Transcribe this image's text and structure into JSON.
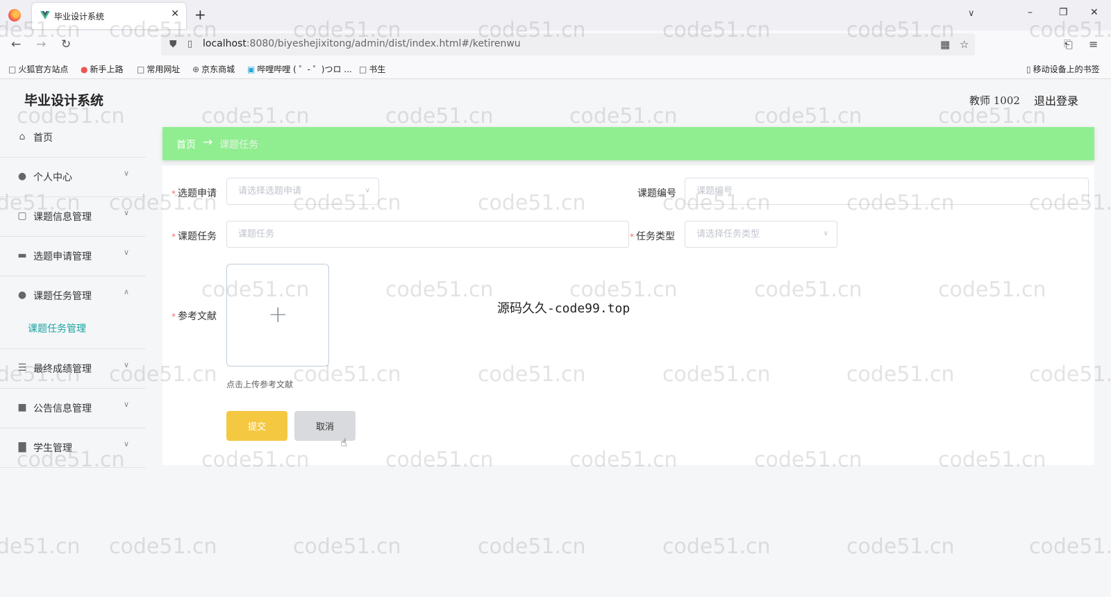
{
  "browser": {
    "tab_title": "毕业设计系统",
    "tab_close": "✕",
    "new_tab": "+",
    "url_host": "localhost",
    "url_rest": ":8080/biyeshejixitong/admin/dist/index.html#/ketirenwu",
    "bookmarks": [
      {
        "icon": "folder-icon",
        "label": "火狐官方站点"
      },
      {
        "icon": "firefox-icon",
        "label": "新手上路"
      },
      {
        "icon": "folder-icon",
        "label": "常用网址"
      },
      {
        "icon": "globe-icon",
        "label": "京东商城"
      },
      {
        "icon": "bilibili-icon",
        "label": "哔哩哔哩 ( ゜- ゜)つロ ..."
      },
      {
        "icon": "folder-icon",
        "label": "书生"
      }
    ],
    "mobile_bookmarks": "移动设备上的书签"
  },
  "app": {
    "title": "毕业设计系统",
    "user": "教师 1002",
    "logout": "退出登录"
  },
  "sidebar": {
    "items": [
      {
        "icon": "home-icon",
        "label": "首页"
      },
      {
        "icon": "user-icon",
        "label": "个人中心"
      },
      {
        "icon": "chat-icon",
        "label": "课题信息管理"
      },
      {
        "icon": "monitor-icon",
        "label": "选题申请管理"
      },
      {
        "icon": "user-icon",
        "label": "课题任务管理"
      },
      {
        "icon": "list-icon",
        "label": "最终成绩管理"
      },
      {
        "icon": "ticket-icon",
        "label": "公告信息管理"
      },
      {
        "icon": "bar-chart-icon",
        "label": "学生管理"
      }
    ],
    "sub_active": "课题任务管理"
  },
  "breadcrumb": {
    "home": "首页",
    "arrow": "→",
    "current": "课题任务"
  },
  "form": {
    "application_label": "选题申请",
    "application_placeholder": "请选择选题申请",
    "topic_no_label": "课题编号",
    "topic_no_placeholder": "课题编号",
    "task_label": "课题任务",
    "task_placeholder": "课题任务",
    "task_type_label": "任务类型",
    "task_type_placeholder": "请选择任务类型",
    "ref_label": "参考文献",
    "upload_tip": "点击上传参考文献",
    "submit": "提交",
    "cancel": "取消",
    "required_mark": "*"
  },
  "overlay_text": "源码久久-code99.top",
  "watermark": "code51.cn",
  "colors": {
    "breadcrumb_bg": "#90ee90",
    "submit_bg": "#f5c842",
    "active_sub": "#1aa3a0"
  }
}
